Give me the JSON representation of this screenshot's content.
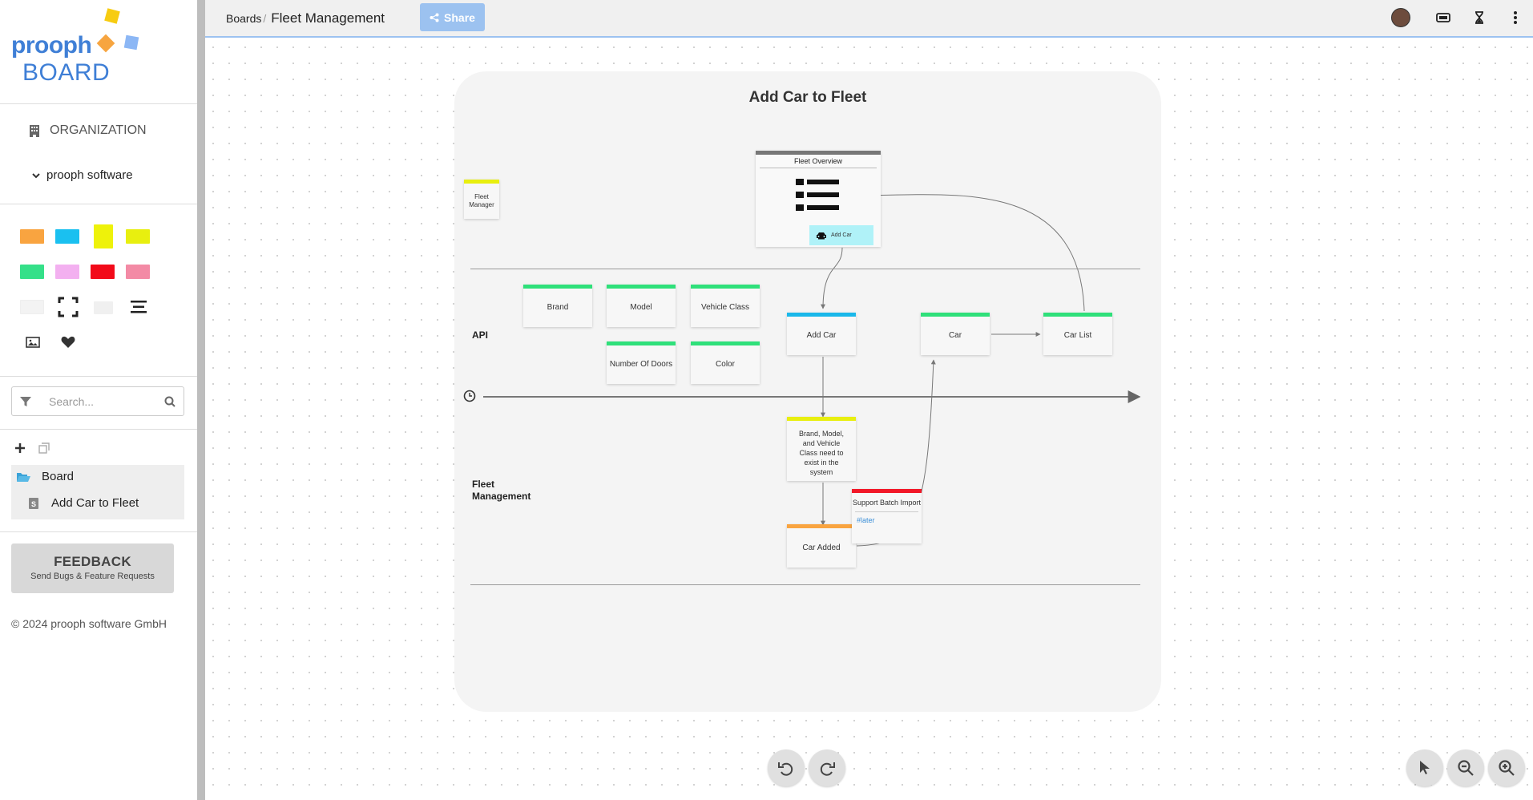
{
  "app": {
    "logo_top": "prooph",
    "logo_bottom": "BOARD",
    "logo_colors": [
      "#f7cc11",
      "#f7a540",
      "#8cb7f5"
    ]
  },
  "sidebar": {
    "organization_label": "ORGANIZATION",
    "team_label": "prooph software",
    "palette": [
      {
        "name": "orange-sticky",
        "color": "#f9a440"
      },
      {
        "name": "blue-sticky",
        "color": "#1ac0f0"
      },
      {
        "name": "yellow-sticky",
        "color": "#eef20a"
      },
      {
        "name": "lime-sticky",
        "color": "#e8ef0f"
      },
      {
        "name": "green-sticky",
        "color": "#35e089"
      },
      {
        "name": "pink-sticky",
        "color": "#f3b0f0"
      },
      {
        "name": "red-sticky",
        "color": "#f20a19"
      },
      {
        "name": "rose-sticky",
        "color": "#f38aa5"
      }
    ],
    "search_placeholder": "Search...",
    "tree": {
      "folder_label": "Board",
      "item_label": "Add Car to Fleet"
    },
    "feedback_title": "FEEDBACK",
    "feedback_subtitle": "Send Bugs & Feature Requests",
    "copyright": "© 2024 prooph software GmbH"
  },
  "topbar": {
    "breadcrumb_root": "Boards",
    "breadcrumb_sep": "/",
    "breadcrumb_current": "Fleet Management",
    "share_label": "Share"
  },
  "board": {
    "title": "Add Car to Fleet",
    "lanes": {
      "api": "API",
      "fleet_management": "Fleet Management"
    },
    "actor": "Fleet Manager",
    "ui": {
      "title": "Fleet Overview",
      "button_label": "Add Car"
    },
    "cards": {
      "brand": "Brand",
      "model": "Model",
      "vehicle_class": "Vehicle Class",
      "number_of_doors": "Number Of Doors",
      "color": "Color",
      "add_car": "Add Car",
      "car": "Car",
      "car_list": "Car List",
      "policy": "Brand, Model, and Vehicle Class need to exist in the system",
      "car_added": "Car Added",
      "hotspot_title": "Support Batch Import",
      "hotspot_tag": "#later"
    },
    "colors": {
      "information": "#2fe07a",
      "command": "#1ab8ea",
      "rule": "#e8ef0f",
      "event": "#f9a440",
      "hotspot": "#f21828",
      "ui": "#777777",
      "actor": "#e8ef0f",
      "ui_button": "#b0f2f8"
    }
  }
}
